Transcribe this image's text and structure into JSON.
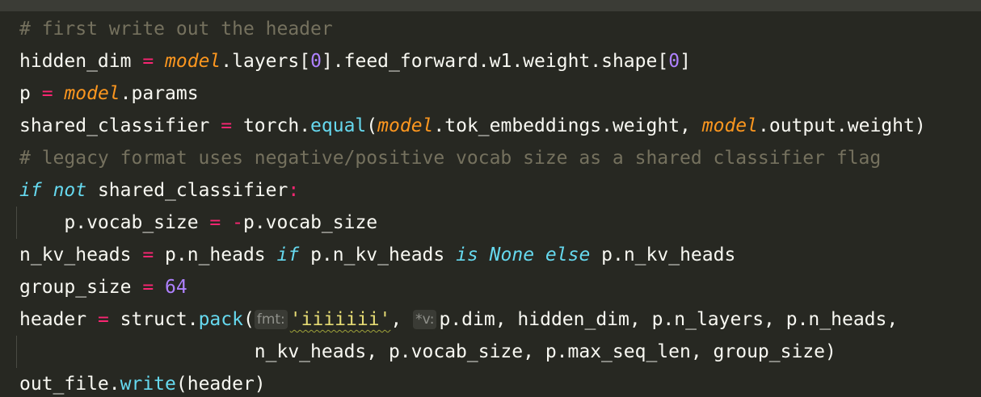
{
  "colors": {
    "background": "#272822",
    "top_bar": "#3b3c36",
    "default": "#f8f8f2",
    "comment": "#75715e",
    "operator": "#f92672",
    "italic_var": "#fd971f",
    "number": "#ae81ff",
    "builtin_function": "#66d9ef",
    "keyword": "#66d9ef",
    "string": "#e6db74",
    "hint_text": "#8f908a"
  },
  "code_lines": [
    {
      "indent_guide": false,
      "tokens": [
        {
          "t": "# first write out the header",
          "c": "comment"
        }
      ]
    },
    {
      "indent_guide": false,
      "tokens": [
        {
          "t": "hidden_dim ",
          "c": "default"
        },
        {
          "t": "=",
          "c": "operator"
        },
        {
          "t": " ",
          "c": "default"
        },
        {
          "t": "model",
          "c": "italic_var",
          "i": true
        },
        {
          "t": ".layers[",
          "c": "default"
        },
        {
          "t": "0",
          "c": "number"
        },
        {
          "t": "].feed_forward.w1.weight.shape[",
          "c": "default"
        },
        {
          "t": "0",
          "c": "number"
        },
        {
          "t": "]",
          "c": "default"
        }
      ]
    },
    {
      "indent_guide": false,
      "tokens": [
        {
          "t": "p ",
          "c": "default"
        },
        {
          "t": "=",
          "c": "operator"
        },
        {
          "t": " ",
          "c": "default"
        },
        {
          "t": "model",
          "c": "italic_var",
          "i": true
        },
        {
          "t": ".params",
          "c": "default"
        }
      ]
    },
    {
      "indent_guide": false,
      "tokens": [
        {
          "t": "shared_classifier ",
          "c": "default"
        },
        {
          "t": "=",
          "c": "operator"
        },
        {
          "t": " torch.",
          "c": "default"
        },
        {
          "t": "equal",
          "c": "builtin_function"
        },
        {
          "t": "(",
          "c": "default"
        },
        {
          "t": "model",
          "c": "italic_var",
          "i": true
        },
        {
          "t": ".tok_embeddings.weight, ",
          "c": "default"
        },
        {
          "t": "model",
          "c": "italic_var",
          "i": true
        },
        {
          "t": ".output.weight)",
          "c": "default"
        }
      ]
    },
    {
      "indent_guide": false,
      "tokens": [
        {
          "t": "# legacy format uses negative/positive vocab size as a shared classifier flag",
          "c": "comment"
        }
      ]
    },
    {
      "indent_guide": false,
      "tokens": [
        {
          "t": "if",
          "c": "keyword",
          "i": true
        },
        {
          "t": " ",
          "c": "default"
        },
        {
          "t": "not",
          "c": "keyword",
          "i": true
        },
        {
          "t": " shared_classifier",
          "c": "default"
        },
        {
          "t": ":",
          "c": "operator"
        }
      ]
    },
    {
      "indent_guide": true,
      "tokens": [
        {
          "t": "    p.vocab_size ",
          "c": "default"
        },
        {
          "t": "=",
          "c": "operator"
        },
        {
          "t": " ",
          "c": "default"
        },
        {
          "t": "-",
          "c": "operator"
        },
        {
          "t": "p.vocab_size",
          "c": "default"
        }
      ]
    },
    {
      "indent_guide": false,
      "tokens": [
        {
          "t": "n_kv_heads ",
          "c": "default"
        },
        {
          "t": "=",
          "c": "operator"
        },
        {
          "t": " p.n_heads ",
          "c": "default"
        },
        {
          "t": "if",
          "c": "keyword",
          "i": true
        },
        {
          "t": " p.n_kv_heads ",
          "c": "default"
        },
        {
          "t": "is",
          "c": "keyword",
          "i": true
        },
        {
          "t": " ",
          "c": "default"
        },
        {
          "t": "None",
          "c": "keyword",
          "i": true
        },
        {
          "t": " ",
          "c": "default"
        },
        {
          "t": "else",
          "c": "keyword",
          "i": true
        },
        {
          "t": " p.n_kv_heads",
          "c": "default"
        }
      ]
    },
    {
      "indent_guide": false,
      "tokens": [
        {
          "t": "group_size ",
          "c": "default"
        },
        {
          "t": "=",
          "c": "operator"
        },
        {
          "t": " ",
          "c": "default"
        },
        {
          "t": "64",
          "c": "number"
        }
      ]
    },
    {
      "indent_guide": false,
      "tokens": [
        {
          "t": "header ",
          "c": "default"
        },
        {
          "t": "=",
          "c": "operator"
        },
        {
          "t": " struct.",
          "c": "default"
        },
        {
          "t": "pack",
          "c": "builtin_function"
        },
        {
          "t": "(",
          "c": "default"
        },
        {
          "hint": "fmt:"
        },
        {
          "t": "'iiiiiii'",
          "c": "string",
          "u": true
        },
        {
          "t": ", ",
          "c": "default"
        },
        {
          "hint": "*v:"
        },
        {
          "t": "p.dim, hidden_dim, p.n_layers, p.n_heads,",
          "c": "default"
        }
      ]
    },
    {
      "indent_guide": true,
      "tokens": [
        {
          "t": "                     n_kv_heads, p.vocab_size, p.max_seq_len, group_size)",
          "c": "default"
        }
      ]
    },
    {
      "indent_guide": false,
      "tokens": [
        {
          "t": "out_file.",
          "c": "default"
        },
        {
          "t": "write",
          "c": "builtin_function"
        },
        {
          "t": "(header)",
          "c": "default"
        }
      ]
    }
  ]
}
